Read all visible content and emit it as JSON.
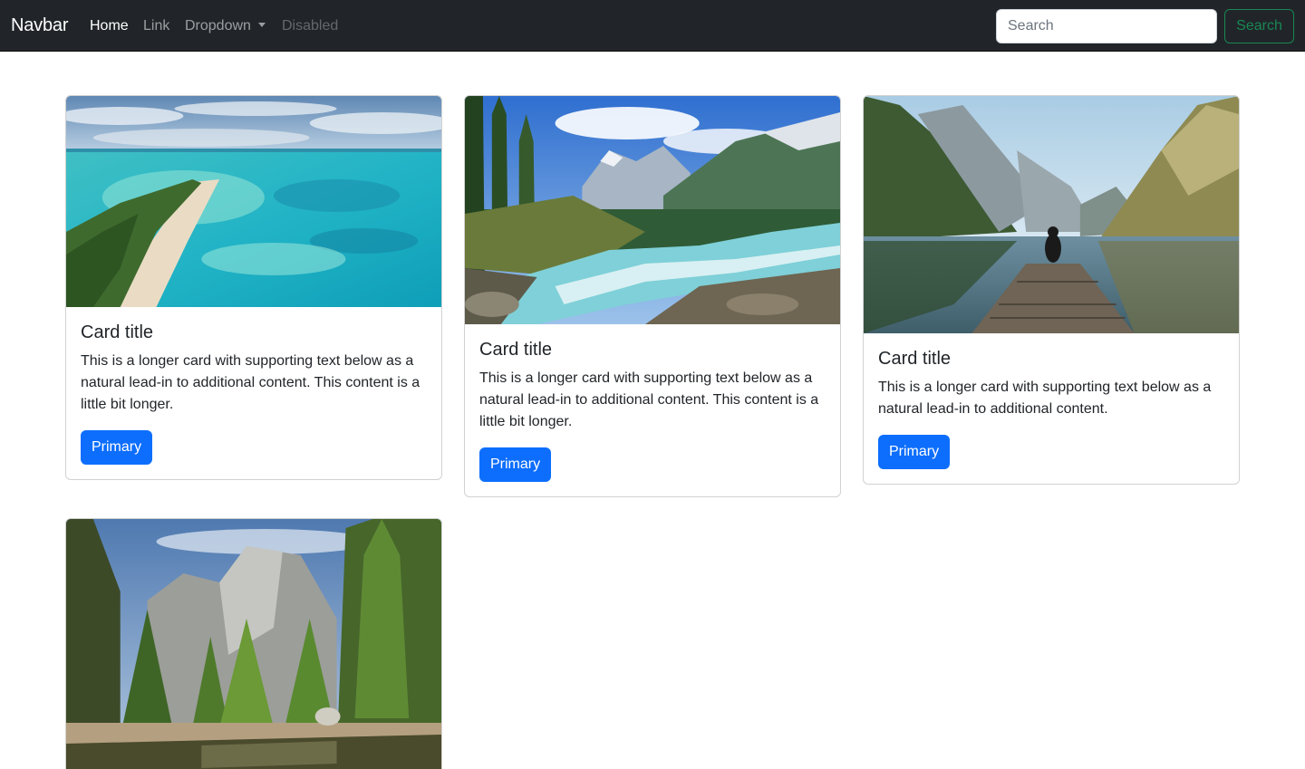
{
  "navbar": {
    "brand": "Navbar",
    "links": [
      {
        "label": "Home"
      },
      {
        "label": "Link"
      },
      {
        "label": "Dropdown"
      },
      {
        "label": "Disabled"
      }
    ],
    "search": {
      "placeholder": "Search",
      "button_label": "Search"
    }
  },
  "cards": [
    {
      "image": "beach-lagoon-photo",
      "title": "Card title",
      "text": "This is a longer card with supporting text below as a natural lead-in to additional content. This content is a little bit longer.",
      "button": "Primary"
    },
    {
      "image": "mountain-river-photo",
      "title": "Card title",
      "text": "This is a longer card with supporting text below as a natural lead-in to additional content. This content is a little bit longer.",
      "button": "Primary"
    },
    {
      "image": "lake-dock-photo",
      "title": "Card title",
      "text": "This is a longer card with supporting text below as a natural lead-in to additional content.",
      "button": "Primary"
    },
    {
      "image": "forest-cliff-photo"
    }
  ],
  "colors": {
    "navbar_bg": "#212529",
    "primary": "#0d6efd",
    "success": "#198754"
  }
}
